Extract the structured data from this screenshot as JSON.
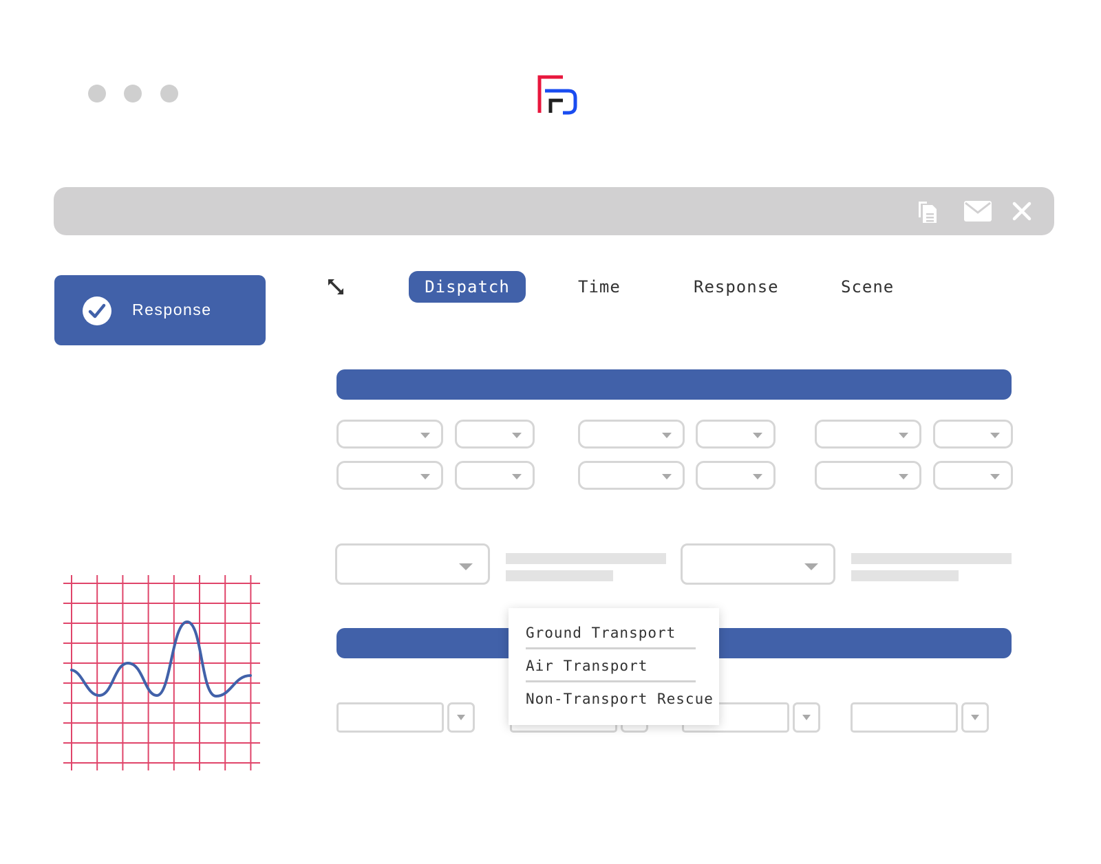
{
  "window": {
    "dots": [
      "close-dot",
      "minimize-dot",
      "zoom-dot"
    ]
  },
  "logo": {
    "name": "app-logo",
    "colors": [
      "#e8173d",
      "#1f1f1f",
      "#1a4cf0"
    ]
  },
  "toolbar": {
    "icons": [
      "copy-icon",
      "mail-icon",
      "close-icon"
    ]
  },
  "sidebar": {
    "response_card": {
      "label": "Response",
      "icon": "check-circle-icon"
    },
    "ecg_chart": {
      "icon": "ecg-grid-icon",
      "grid_color": "#e0456a",
      "line_color": "#4161a9"
    }
  },
  "tabs": [
    {
      "label": "Dispatch",
      "active": true
    },
    {
      "label": "Time",
      "active": false
    },
    {
      "label": "Response",
      "active": false
    },
    {
      "label": "Scene",
      "active": false
    }
  ],
  "expand_icon": "expand-icon",
  "dropdown_menu": {
    "items": [
      "Ground Transport",
      "Air Transport",
      "Non-Transport Rescue"
    ]
  },
  "colors": {
    "accent": "#4161a9",
    "border": "#d6d6d6",
    "toolbar": "#d1d0d1"
  }
}
